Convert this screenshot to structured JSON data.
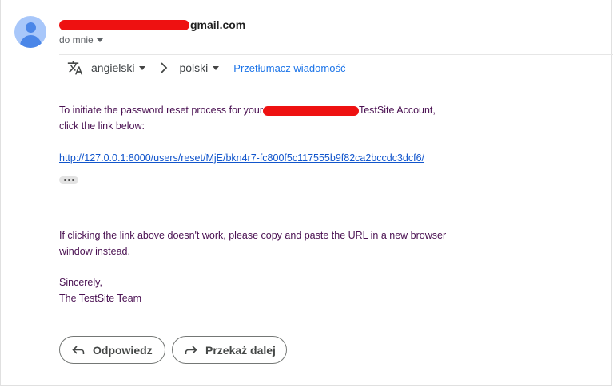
{
  "header": {
    "sender_suffix": "gmail.com",
    "recipient_label": "do mnie"
  },
  "translate_bar": {
    "from_language": "angielski",
    "to_language": "polski",
    "translate_link": "Przetłumacz wiadomość"
  },
  "message": {
    "line1_before": "To initiate the password reset process for your",
    "line1_after": "TestSite Account,",
    "line2": "click the link below:",
    "reset_link": "http://127.0.0.1:8000/users/reset/MjE/bkn4r7-fc800f5c117555b9f82ca2bccdc3dcf6/",
    "fallback_text": "If clicking the link above doesn't work, please copy and paste the URL in a new browser window instead.",
    "closing": "Sincerely,",
    "signature": "The TestSite Team"
  },
  "actions": {
    "reply_label": "Odpowiedz",
    "forward_label": "Przekaż dalej"
  },
  "colors": {
    "link": "#1155cc",
    "body_text": "#4a1152",
    "avatar_bg": "#a8c7fa",
    "avatar_fg": "#4a86e8",
    "redaction": "#ee1111"
  },
  "icons": [
    "avatar-icon",
    "translate-icon",
    "chevron-right-icon",
    "more-dots-icon",
    "reply-icon",
    "forward-icon"
  ]
}
